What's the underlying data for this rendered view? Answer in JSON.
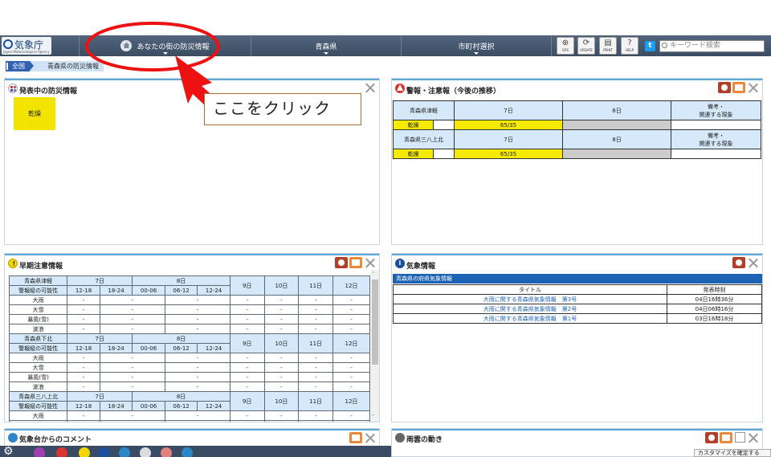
{
  "header": {
    "logo_text": "気象庁",
    "logo_sub": "Japan Meteorological Agency",
    "nav1": "あなたの街の防災情報",
    "nav2": "青森県",
    "nav3": "市町村選択",
    "toolbar": {
      "gps": "GPS",
      "update": "UPDATE",
      "print": "PRINT",
      "help": "HELP"
    },
    "search_placeholder": "キーワード検索"
  },
  "breadcrumb": {
    "item1": "全国",
    "item2": "青森県の防災情報"
  },
  "callout_text": "ここをクリック",
  "panels": {
    "current": {
      "title": "発表中の防災情報",
      "badge": "乾燥"
    },
    "warnings": {
      "title": "警報・注意報（今後の推移）",
      "rows": [
        {
          "area": "青森県津軽",
          "d1": "7日",
          "d2": "8日",
          "note": "備考・\n関連する現象",
          "label": "乾燥",
          "value": "65/35"
        },
        {
          "area": "青森県三八上北",
          "d1": "7日",
          "d2": "8日",
          "note": "備考・\n関連する現象",
          "label": "乾燥",
          "value": "65/35"
        }
      ]
    },
    "early": {
      "title": "早期注意情報",
      "days": [
        "7日",
        "8日",
        "9日",
        "10日",
        "11日",
        "12日"
      ],
      "possibility_label": "警報級の可能性",
      "times": [
        "12-18",
        "18-24",
        "00-06",
        "06-12",
        "12-24"
      ],
      "items": [
        "大雨",
        "大雪",
        "暴風(雪)",
        "波浪"
      ],
      "dash": "-",
      "areas": [
        "青森県津軽",
        "青森県下北",
        "青森県三八上北"
      ]
    },
    "weather": {
      "title": "気象情報",
      "section": "青森県の府県気象情報",
      "col_title": "タイトル",
      "col_time": "発表時刻",
      "rows": [
        {
          "title": "大雨に関する青森県気象情報　第3号",
          "time": "04日16時36分"
        },
        {
          "title": "大雨に関する青森県気象情報　第2号",
          "time": "04日06時16分"
        },
        {
          "title": "大雨に関する青森県気象情報　第1号",
          "time": "03日16時18分"
        }
      ]
    },
    "comment": {
      "title": "気象台からのコメント"
    },
    "radar": {
      "title": "雨雲の動き"
    }
  },
  "customize_label": "カスタマイズを確定する"
}
